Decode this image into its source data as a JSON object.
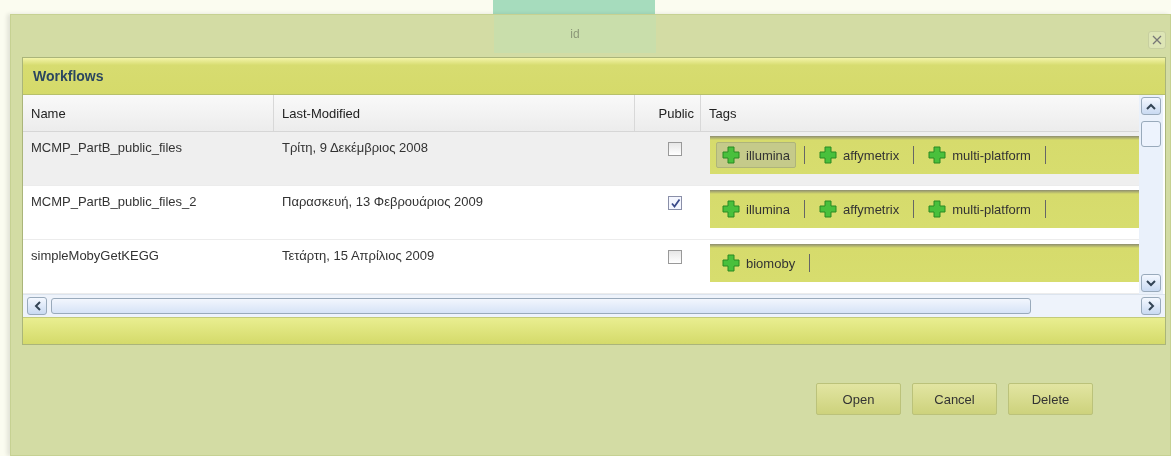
{
  "background": {
    "column_header": "id"
  },
  "panel": {
    "title": "Workflows"
  },
  "table": {
    "columns": [
      "Name",
      "Last-Modified",
      "Public",
      "Tags"
    ],
    "rows": [
      {
        "name": "MCMP_PartB_public_files",
        "modified": "Τρίτη, 9 Δεκέμβριος 2008",
        "public": false,
        "selected": true,
        "tags": [
          {
            "label": "illumina",
            "selected": true
          },
          {
            "label": "affymetrix",
            "selected": false
          },
          {
            "label": "multi-platform",
            "selected": false
          }
        ]
      },
      {
        "name": "MCMP_PartB_public_files_2",
        "modified": "Παρασκευή, 13 Φεβρουάριος 2009",
        "public": true,
        "selected": false,
        "tags": [
          {
            "label": "illumina",
            "selected": false
          },
          {
            "label": "affymetrix",
            "selected": false
          },
          {
            "label": "multi-platform",
            "selected": false
          }
        ]
      },
      {
        "name": "simpleMobyGetKEGG",
        "modified": "Τετάρτη, 15 Απρίλιος 2009",
        "public": false,
        "selected": false,
        "tags": [
          {
            "label": "biomoby",
            "selected": false
          }
        ]
      }
    ]
  },
  "buttons": [
    "Open",
    "Cancel",
    "Delete"
  ]
}
